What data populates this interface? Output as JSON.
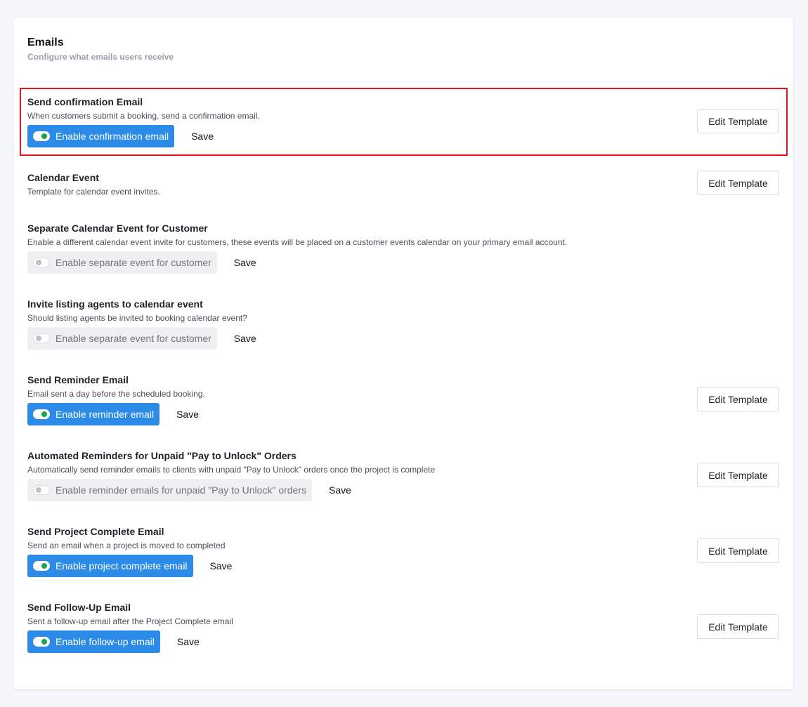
{
  "header": {
    "title": "Emails",
    "subtitle": "Configure what emails users receive"
  },
  "sections": [
    {
      "title": "Send confirmation Email",
      "description": "When customers submit a booking, send a confirmation email.",
      "toggle_label": "Enable confirmation email",
      "toggle_on": true,
      "save_label": "Save",
      "edit_label": "Edit Template"
    },
    {
      "title": "Calendar Event",
      "description": "Template for calendar event invites.",
      "edit_label": "Edit Template"
    },
    {
      "title": "Separate Calendar Event for Customer",
      "description": "Enable a different calendar event invite for customers, these events will be placed on a customer events calendar on your primary email account.",
      "toggle_label": "Enable separate event for customer",
      "toggle_on": false,
      "save_label": "Save"
    },
    {
      "title": "Invite listing agents to calendar event",
      "description": "Should listing agents be invited to booking calendar event?",
      "toggle_label": "Enable separate event for customer",
      "toggle_on": false,
      "save_label": "Save"
    },
    {
      "title": "Send Reminder Email",
      "description": "Email sent a day before the scheduled booking.",
      "toggle_label": "Enable reminder email",
      "toggle_on": true,
      "save_label": "Save",
      "edit_label": "Edit Template"
    },
    {
      "title": "Automated Reminders for Unpaid \"Pay to Unlock\" Orders",
      "description": "Automatically send reminder emails to clients with unpaid \"Pay to Unlock\" orders once the project is complete",
      "toggle_label": "Enable reminder emails for unpaid \"Pay to Unlock\" orders",
      "toggle_on": false,
      "save_label": "Save",
      "edit_label": "Edit Template"
    },
    {
      "title": "Send Project Complete Email",
      "description": "Send an email when a project is moved to completed",
      "toggle_label": "Enable project complete email",
      "toggle_on": true,
      "save_label": "Save",
      "edit_label": "Edit Template"
    },
    {
      "title": "Send Follow-Up Email",
      "description": "Sent a follow-up email after the Project Complete email",
      "toggle_label": "Enable follow-up email",
      "toggle_on": true,
      "save_label": "Save",
      "edit_label": "Edit Template"
    }
  ],
  "colors": {
    "toggle_on_bg": "#2b8be6",
    "toggle_knob_on": "#1aa257",
    "highlight_border": "#e8141c"
  }
}
